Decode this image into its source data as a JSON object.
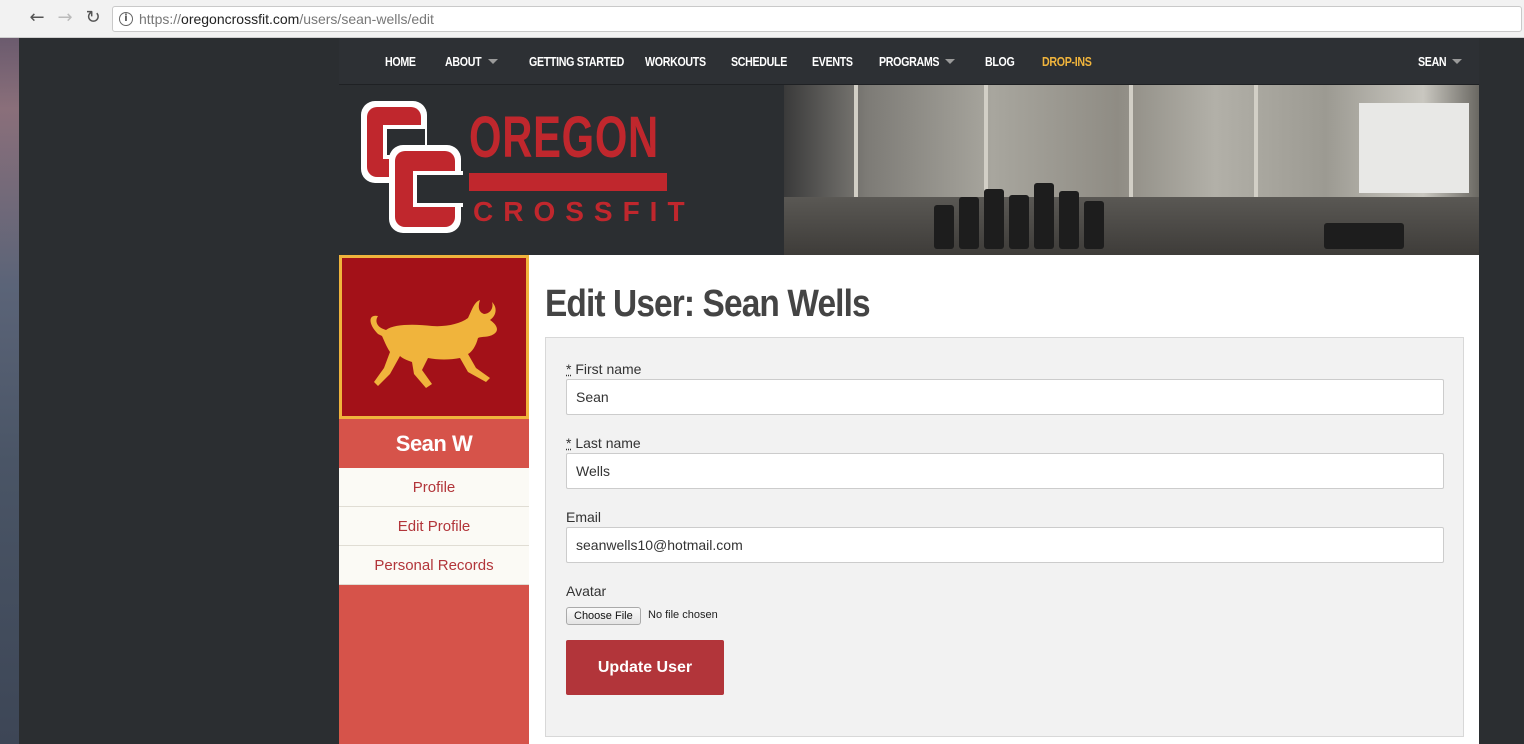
{
  "browser": {
    "url_scheme": "https://",
    "url_domain": "oregoncrossfit.com",
    "url_path": "/users/sean-wells/edit",
    "back_icon": "arrow-left-icon",
    "forward_icon": "arrow-right-icon",
    "reload_icon": "reload-icon",
    "info_icon": "info-icon"
  },
  "nav": {
    "items": [
      {
        "label": "HOME"
      },
      {
        "label": "ABOUT",
        "dropdown": true
      },
      {
        "label": "GETTING STARTED"
      },
      {
        "label": "WORKOUTS"
      },
      {
        "label": "SCHEDULE"
      },
      {
        "label": "EVENTS"
      },
      {
        "label": "PROGRAMS",
        "dropdown": true
      },
      {
        "label": "BLOG"
      },
      {
        "label": "DROP-INS",
        "highlight": true
      }
    ],
    "user_menu": "SEAN"
  },
  "brand": {
    "name": "OREGON",
    "subname": "CROSSFIT",
    "monogram": "CC",
    "color": "#c0272d",
    "accent": "#f0b43c"
  },
  "sidebar": {
    "name": "Sean W",
    "avatar_icon": "bull-icon",
    "links": [
      "Profile",
      "Edit Profile",
      "Personal Records"
    ]
  },
  "main": {
    "title": "Edit User: Sean Wells",
    "fields": {
      "first_name": {
        "required_mark": "*",
        "label": "First name",
        "value": "Sean"
      },
      "last_name": {
        "required_mark": "*",
        "label": "Last name",
        "value": "Wells"
      },
      "email": {
        "label": "Email",
        "value": "seanwells10@hotmail.com"
      },
      "avatar": {
        "label": "Avatar",
        "button": "Choose File",
        "status": "No file chosen"
      }
    },
    "submit_label": "Update User"
  }
}
